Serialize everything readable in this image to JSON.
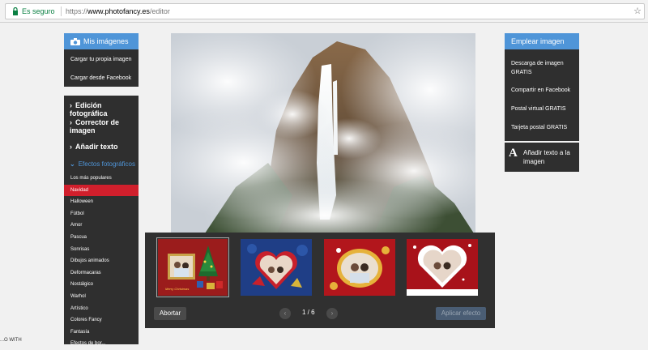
{
  "browser": {
    "secure_label": "Es seguro",
    "url_protocol": "https://",
    "url_domain": "www.photofancy.es",
    "url_path": "/editor"
  },
  "left_top": {
    "title": "Mis imágenes",
    "items": [
      "Cargar tu propia imagen",
      "Cargar desde Facebook"
    ]
  },
  "left_menu": {
    "sections": [
      "Edición fotográfica",
      "Corrector de imagen",
      "Añadir texto"
    ],
    "effects_title": "Efectos fotográficos",
    "effects": [
      "Los más populares",
      "Navidad",
      "Halloween",
      "Fútbol",
      "Amor",
      "Pascua",
      "Sonrisas",
      "Dibujos animados",
      "Deformacaras",
      "Nostálgico",
      "Warhol",
      "Artístico",
      "Colores Fancy",
      "Fantasía",
      "Efectos de bor..."
    ],
    "active_effect_index": 1
  },
  "right_top": {
    "title": "Emplear imagen",
    "items": [
      "Descarga de imagen GRATIS",
      "Compartir en Facebook",
      "Postal virtual GRATIS",
      "Tarjeta postal GRATIS"
    ]
  },
  "right_text": {
    "icon": "A",
    "label": "Añadir texto a la imagen"
  },
  "strip": {
    "cancel_label": "Abortar",
    "page": "1 / 6",
    "apply_label": "Aplicar efecto",
    "thumb1_caption": "Merry Christmas"
  },
  "footer": {
    "text": "...O WITH"
  },
  "colors": {
    "accent": "#4f95d8",
    "panel": "#2f2f2f",
    "active": "#d01f2c"
  }
}
